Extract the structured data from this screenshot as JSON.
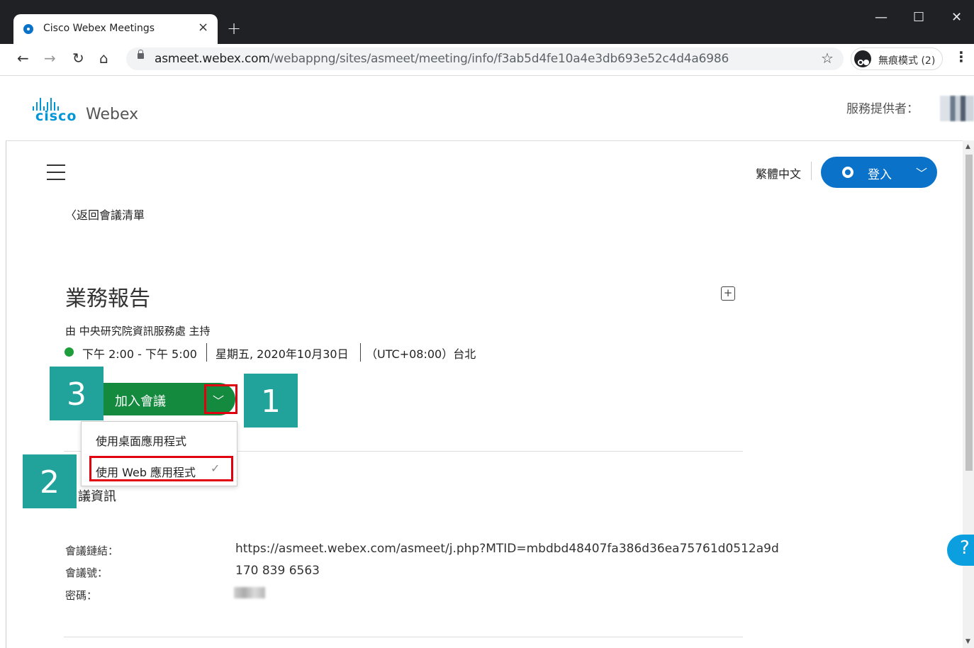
{
  "browser": {
    "tab_title": "Cisco Webex Meetings",
    "tab_close": "×",
    "new_tab": "+",
    "window_minimize": "—",
    "window_maximize": "☐",
    "window_close": "✕",
    "url_host": "asmeet.webex.com",
    "url_path": "/webappng/sites/asmeet/meeting/info/f3ab5d4fe10a4e3db693e52c4d4a6986",
    "incognito_label": "無痕模式 (2)"
  },
  "header": {
    "brand_cisco": "cisco",
    "brand_webex": "Webex",
    "provider_label": "服務提供者："
  },
  "topbar": {
    "language": "繁體中文",
    "signin_label": "登入"
  },
  "nav": {
    "back_label": "返回會議清單"
  },
  "meeting": {
    "title": "業務報告",
    "host_line": "由 中央研究院資訊服務處 主持",
    "time_range": "下午 2:00 - 下午 5:00",
    "date": "星期五, 2020年10月30日",
    "timezone": "（UTC+08:00）台北",
    "join_label": "加入會議",
    "join_options": [
      {
        "label": "使用桌面應用程式",
        "selected": false
      },
      {
        "label": "使用 Web 應用程式",
        "selected": true
      }
    ]
  },
  "info": {
    "heading": "議資訊",
    "link_label": "會議鏈結：",
    "link_value": "https://asmeet.webex.com/asmeet/j.php?MTID=mbdbd48407fa386d36ea75761d0512a9d",
    "number_label": "會議號：",
    "number_value": "170 839 6563",
    "password_label": "密碼："
  },
  "annotations": {
    "step1": "1",
    "step2": "2",
    "step3": "3",
    "badge_color": "#21a39b",
    "highlight_color": "#e00010"
  },
  "help": "?"
}
